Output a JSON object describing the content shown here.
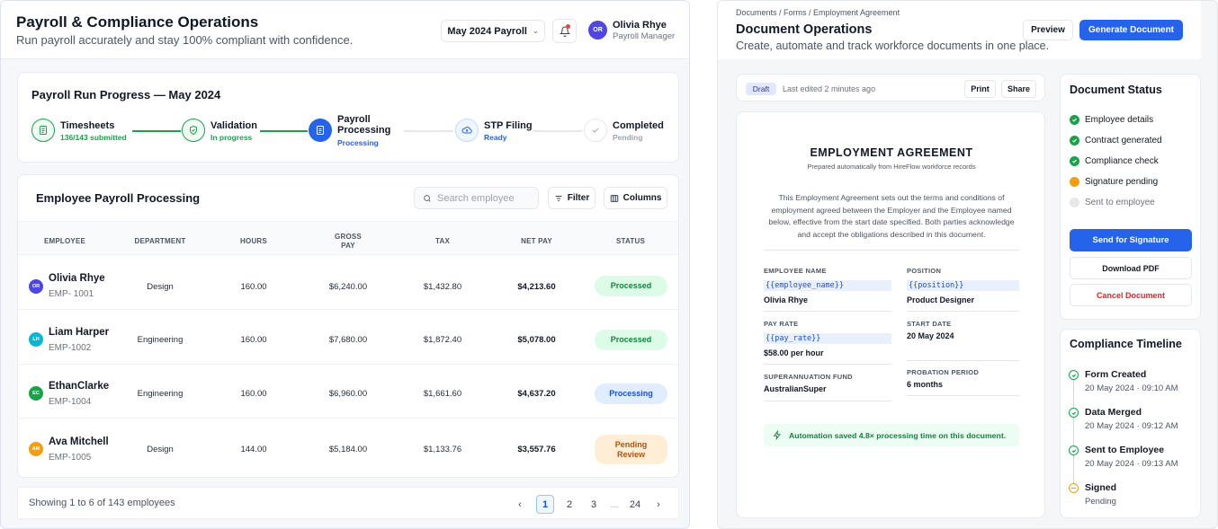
{
  "payroll": {
    "title": "Payroll & Compliance Operations",
    "subtitle": "Run payroll accurately and stay 100% compliant with confidence.",
    "period": "May 2024 Payroll",
    "user": {
      "initials": "OR",
      "name": "Olivia Rhye",
      "role": "Payroll Manager"
    },
    "progress": {
      "title": "Payroll Run Progress — May 2024",
      "steps": [
        {
          "label": "Timesheets",
          "status": "136/143 submitted"
        },
        {
          "label": "Validation",
          "status": "In progress"
        },
        {
          "label": "Payroll Processing",
          "status": "Processing"
        },
        {
          "label": "STP Filing",
          "status": "Ready"
        },
        {
          "label": "Completed",
          "status": "Pending"
        }
      ]
    },
    "table": {
      "title": "Employee Payroll Processing",
      "search_placeholder": "Search employee",
      "filter_label": "Filter",
      "columns_label": "Columns",
      "headers": [
        "EMPLOYEE",
        "DEPARTMENT",
        "HOURS",
        "GROSS PAY",
        "TAX",
        "NET PAY",
        "STATUS"
      ],
      "rows": [
        {
          "initials": "OR",
          "name": "Olivia Rhye",
          "id": "EMP- 1001",
          "department": "Design",
          "hours": "160.00",
          "gross": "$6,240.00",
          "tax": "$1,432.80",
          "net": "$4,213.60",
          "status": "Processed"
        },
        {
          "initials": "LH",
          "name": "Liam Harper",
          "id": "EMP-1002",
          "department": "Engineering",
          "hours": "160.00",
          "gross": "$7,680.00",
          "tax": "$1,872.40",
          "net": "$5,078.00",
          "status": "Processed"
        },
        {
          "initials": "EC",
          "name": "EthanClarke",
          "id": "EMP-1004",
          "department": "Engineering",
          "hours": "160.00",
          "gross": "$6,960.00",
          "tax": "$1,661.60",
          "net": "$4,637.20",
          "status": "Processing"
        },
        {
          "initials": "AM",
          "name": "Ava Mitchell",
          "id": "EMP-1005",
          "department": "Design",
          "hours": "144.00",
          "gross": "$5,184.00",
          "tax": "$1,133.76",
          "net": "$3,557.76",
          "status": "Pending Review"
        }
      ]
    },
    "footer": {
      "info": "Showing 1 to 6 of 143 employees",
      "pages": [
        "1",
        "2",
        "3",
        "...",
        "24"
      ]
    }
  },
  "documents": {
    "breadcrumb": "Documents / Forms / Employment Agreement",
    "title": "Document Operations",
    "subtitle": "Create, automate and track workforce documents in one place.",
    "preview_label": "Preview",
    "generate_label": "Generate Document",
    "draft_label": "Draft",
    "edited": "Last edited 2 minutes ago",
    "print_label": "Print",
    "share_label": "Share",
    "doc": {
      "title": "EMPLOYMENT AGREEMENT",
      "subtitle": "Prepared automatically from HireFlow workforce records",
      "paragraph": "This Employment Agreement sets out the terms and conditions of employment agreed between the Employer and the Employee named below, effective from the start date specified. Both parties acknowledge and accept the obligations described in this document.",
      "fields": {
        "employee_name": {
          "label": "EMPLOYEE NAME",
          "token": "{{employee_name}}",
          "value": "Olivia Rhye"
        },
        "position": {
          "label": "POSITION",
          "token": "{{position}}",
          "value": "Product Designer"
        },
        "pay_rate": {
          "label": "PAY RATE",
          "token": "{{pay_rate}}",
          "value": "$58.00 per hour"
        },
        "start_date": {
          "label": "START DATE",
          "value": "20 May 2024"
        },
        "super_fund": {
          "label": "SUPERANNUATION FUND",
          "value": "AustralianSuper"
        },
        "probation": {
          "label": "PROBATION PERIOD",
          "value": "6 months"
        }
      },
      "automation_note": "Automation saved 4.8× processing time on this document."
    },
    "status": {
      "title": "Document Status",
      "items": [
        "Employee details",
        "Contract generated",
        "Compliance check",
        "Signature pending",
        "Sent to employee"
      ],
      "send_label": "Send for Signature",
      "download_label": "Download PDF",
      "cancel_label": "Cancel Document"
    },
    "timeline": {
      "title": "Compliance Timeline",
      "events": [
        {
          "title": "Form Created",
          "time": "20 May 2024 · 09:10 AM"
        },
        {
          "title": "Data Merged",
          "time": "20 May 2024 · 09:12 AM"
        },
        {
          "title": "Sent to Employee",
          "time": "20 May 2024 · 09:13 AM"
        },
        {
          "title": "Signed",
          "time": "Pending"
        }
      ]
    }
  },
  "colors": {
    "primary": "#2563eb",
    "success": "#16a34a",
    "warning": "#f59e0b",
    "danger": "#dc2626"
  }
}
